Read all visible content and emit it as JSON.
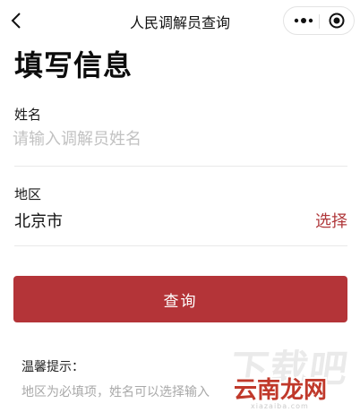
{
  "navbar": {
    "title": "人民调解员查询",
    "back_icon": "chevron-left-icon",
    "more_icon": "more-dots-icon",
    "close_icon": "target-close-icon"
  },
  "form": {
    "title": "填写信息",
    "name_label": "姓名",
    "name_placeholder": "请输入调解员姓名",
    "name_value": "",
    "region_label": "地区",
    "region_value": "北京市",
    "select_label": "选择"
  },
  "query_button": "查询",
  "tips": {
    "title": "温馨提示：",
    "text": "地区为必填项，姓名可以选择输入"
  },
  "watermark": {
    "back": "下载吧",
    "front": "云南龙网",
    "domain": "xiazaiba.com"
  },
  "colors": {
    "accent": "#b43438",
    "link": "#b0383b"
  }
}
